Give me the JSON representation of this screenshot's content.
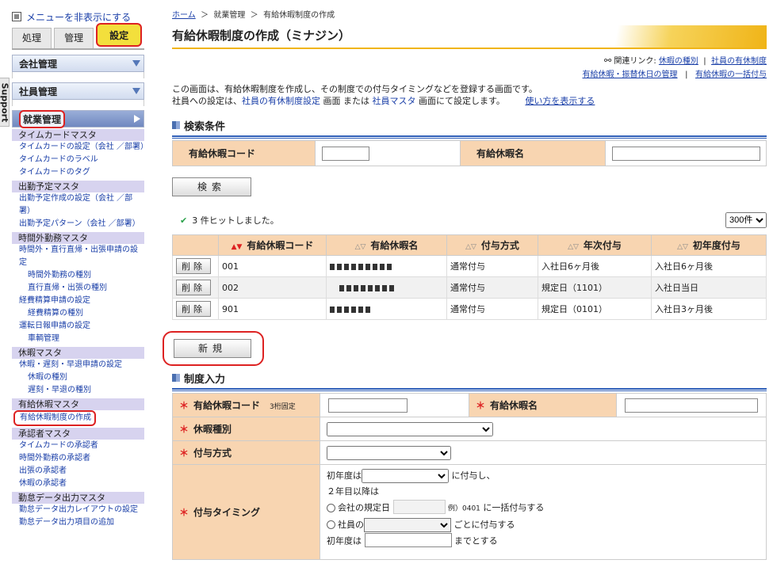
{
  "support_tab": "Support",
  "sidebar": {
    "hide_menu": "メニューを非表示にする",
    "tabs": [
      "処理",
      "管理",
      "設定"
    ],
    "menu_heads": [
      "会社管理",
      "社員管理",
      "就業管理"
    ],
    "sections": [
      {
        "title": "タイムカードマスタ",
        "links": [
          {
            "label": "タイムカードの設定（会社 ／部署）"
          },
          {
            "label": "タイムカードのラベル"
          },
          {
            "label": "タイムカードのタグ"
          }
        ]
      },
      {
        "title": "出勤予定マスタ",
        "links": [
          {
            "label": "出勤予定作成の設定（会社 ／部署）"
          },
          {
            "label": "出勤予定パターン（会社 ／部署）"
          }
        ]
      },
      {
        "title": "時間外勤務マスタ",
        "links": [
          {
            "label": "時間外・直行直帰・出張申請の設定"
          },
          {
            "label": "時間外勤務の種別",
            "sub": true
          },
          {
            "label": "直行直帰・出張の種別",
            "sub": true
          },
          {
            "label": "経費精算申請の設定"
          },
          {
            "label": "経費精算の種別",
            "sub": true
          },
          {
            "label": "運転日報申請の設定"
          },
          {
            "label": "車輌管理",
            "sub": true
          }
        ]
      },
      {
        "title": "休暇マスタ",
        "links": [
          {
            "label": "休暇・遅刻・早退申請の設定"
          },
          {
            "label": "休暇の種別",
            "sub": true
          },
          {
            "label": "遅刻・早退の種別",
            "sub": true
          }
        ]
      },
      {
        "title": "有給休暇マスタ",
        "links": [
          {
            "label": "有給休暇制度の作成"
          }
        ]
      },
      {
        "title": "承認者マスタ",
        "links": [
          {
            "label": "タイムカードの承認者"
          },
          {
            "label": "時間外勤務の承認者"
          },
          {
            "label": "出張の承認者"
          },
          {
            "label": "休暇の承認者"
          }
        ]
      },
      {
        "title": "勤怠データ出力マスタ",
        "links": [
          {
            "label": "勤怠データ出力レイアウトの設定"
          },
          {
            "label": "勤怠データ出力項目の追加"
          }
        ]
      }
    ]
  },
  "breadcrumb": {
    "home": "ホーム",
    "sep": "＞",
    "level1": "就業管理",
    "current": "有給休暇制度の作成"
  },
  "page_title": "有給休暇制度の作成（ミナジン）",
  "related": {
    "label": "関連リンク:",
    "links1": [
      "休暇の種別",
      "社員の有休制度"
    ],
    "links2": [
      "有給休暇・振替休日の管理",
      "有給休暇の一括付与"
    ],
    "divider": "|"
  },
  "description": {
    "line1": "この画面は、有給休暇制度を作成し、その制度での付与タイミングなどを登録する画面です。",
    "line2_a": "社員への設定は、",
    "line2_link1": "社員の有休制度設定",
    "line2_b": " 画面 または ",
    "line2_link2": "社員マスタ",
    "line2_c": " 画面にて設定します。",
    "howto": "使い方を表示する"
  },
  "search": {
    "heading": "検索条件",
    "code_label": "有給休暇コード",
    "code_value": "",
    "name_label": "有給休暇名",
    "name_value": "",
    "button": "検索"
  },
  "results": {
    "hit_text": "3 件ヒットしました。",
    "per_page": "300件",
    "columns": [
      "有給休暇コード",
      "有給休暇名",
      "付与方式",
      "年次付与",
      "初年度付与"
    ],
    "delete_label": "削除",
    "rows": [
      {
        "code": "001",
        "method": "通常付与",
        "annual": "入社日6ヶ月後",
        "first": "入社日6ヶ月後"
      },
      {
        "code": "002",
        "method": "通常付与",
        "annual": "規定日（1101）",
        "first": "入社日当日"
      },
      {
        "code": "901",
        "method": "通常付与",
        "annual": "規定日（0101）",
        "first": "入社日3ヶ月後"
      }
    ]
  },
  "new_button": "新規",
  "form": {
    "heading": "制度入力",
    "required_mark": "＊",
    "code_label": "有給休暇コード",
    "code_note": "3桁固定",
    "name_label": "有給休暇名",
    "type_label": "休暇種別",
    "method_label": "付与方式",
    "timing_label": "付与タイミング",
    "timing": {
      "first_prefix": "初年度は",
      "first_suffix": "に付与し、",
      "second_year": "２年目以降は",
      "opt1_prefix": "会社の規定日",
      "opt1_example": "例）0401",
      "opt1_suffix": "に一括付与する",
      "opt2_prefix": "社員の",
      "opt2_suffix": "ごとに付与する",
      "cut_prefix": "初年度は",
      "cut_suffix": "までとする"
    }
  }
}
